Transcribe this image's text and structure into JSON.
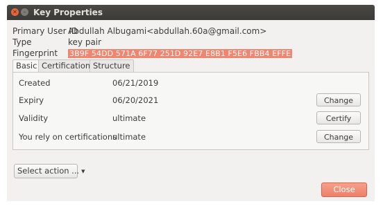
{
  "window": {
    "title": "Key Properties",
    "close_glyph": "✕",
    "minimize_glyph": "–"
  },
  "info": {
    "primary_user_id_label": "Primary User ID",
    "primary_user_id_value": "Abdullah Albugami<abdullah.60a@gmail.com>",
    "type_label": "Type",
    "type_value": "key pair",
    "fingerprint_label": "Fingerprint",
    "fingerprint_value": "3B9F 54DD 571A 6F77 251D 92E7 E8B1 F5E6 FBB4 EFFE"
  },
  "tabs": [
    "Basic",
    "Certifications",
    "Structure"
  ],
  "basic": {
    "rows": [
      {
        "label": "Created",
        "value": "06/21/2019",
        "button": ""
      },
      {
        "label": "Expiry",
        "value": "06/20/2021",
        "button": "Change"
      },
      {
        "label": "Validity",
        "value": "ultimate",
        "button": "Certify"
      },
      {
        "label": "You rely on certifications",
        "value": "ultimate",
        "button": "Change"
      }
    ]
  },
  "footer": {
    "select_action_label": "Select action ...",
    "select_caret_icon": "chevron-down-icon",
    "close_label": "Close"
  },
  "colors": {
    "titlebar": "#3b3a36",
    "fingerprint_highlight": "#f1856f",
    "close_button": "#ee8069"
  }
}
